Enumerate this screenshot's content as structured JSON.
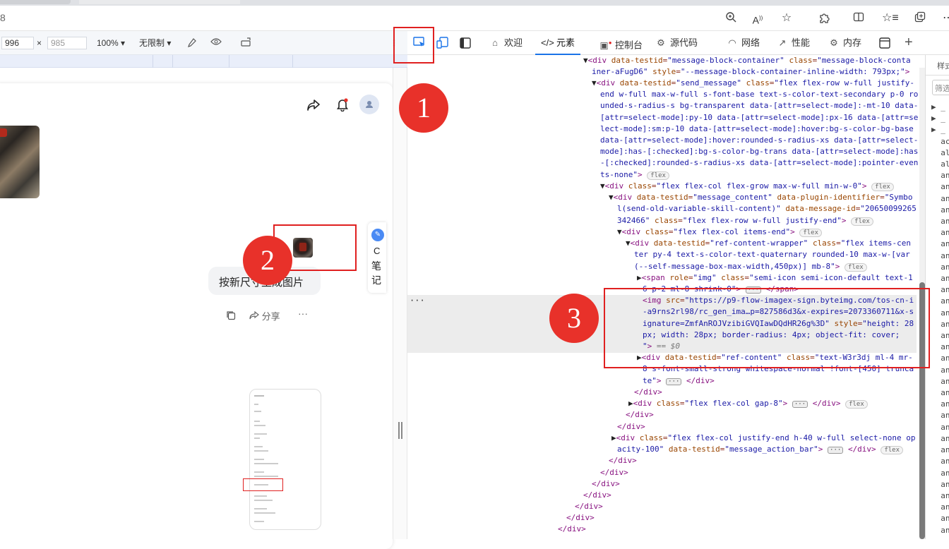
{
  "browser": {
    "url_fragment": "8",
    "icons": [
      "zoom-icon",
      "read-aloud-icon",
      "favorite-star-icon",
      "extensions-icon",
      "split-screen-icon",
      "favorites-icon",
      "collections-icon"
    ]
  },
  "device_toolbar": {
    "width_value": "996",
    "times": "×",
    "height_value": "985",
    "zoom": "100% ▾",
    "throttle": "无限制 ▾"
  },
  "chat": {
    "user_message": "按新尺寸生成图片",
    "share_label": "分享",
    "more_label": "···",
    "side_note": {
      "letter": "C",
      "line1": "笔",
      "line2": "记"
    }
  },
  "devtools": {
    "tabs": [
      {
        "label": "欢迎",
        "icon": "home-icon"
      },
      {
        "label": "元素",
        "icon": "code-icon"
      },
      {
        "label": "控制台",
        "icon": "console-icon"
      },
      {
        "label": "源代码",
        "icon": "sources-icon"
      },
      {
        "label": "网络",
        "icon": "wifi-icon"
      },
      {
        "label": "性能",
        "icon": "performance-icon"
      },
      {
        "label": "内存",
        "icon": "memory-icon"
      }
    ],
    "styles_label": "样式",
    "filter_label": "筛选",
    "ellipsis_dots": "···",
    "selected_suffix": "== $0"
  },
  "annotations": {
    "badge1": "1",
    "badge2": "2",
    "badge3": "3"
  },
  "colors": {
    "badge_red": "#e8312a",
    "box_red": "#e02020",
    "devtools_accent": "#1a73e8"
  }
}
